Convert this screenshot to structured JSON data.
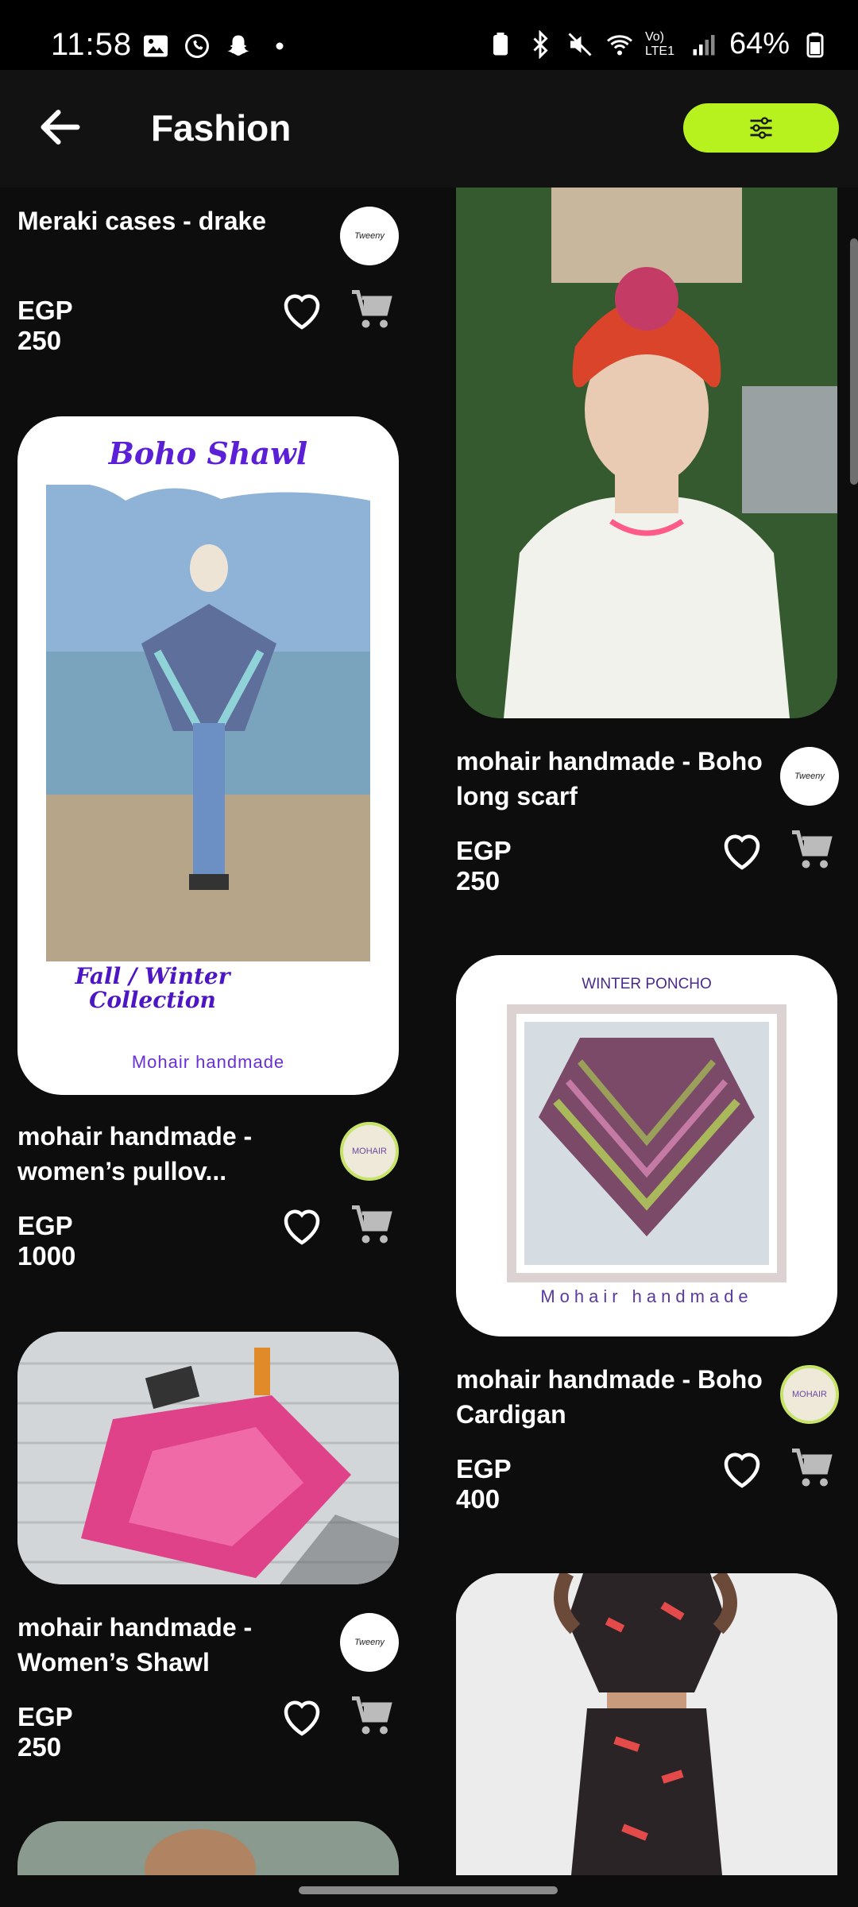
{
  "status": {
    "time": "11:58",
    "battery": "64%",
    "network": "Vo) LTE1"
  },
  "header": {
    "title": "Fashion",
    "icons": {
      "back": "back-arrow-icon",
      "filter": "filter-sliders-icon"
    }
  },
  "products": [
    {
      "name": "Meraki cases  - drake",
      "price": "EGP 250"
    },
    {
      "name": "mohair handmade - Boho long scarf",
      "price": "EGP 250"
    },
    {
      "name": "mohair handmade - women’s pullov...",
      "price": "EGP 1000",
      "image_text": {
        "title": "Boho Shawl",
        "subtitle": "Fall / Winter Collection",
        "footer": "Mohair handmade"
      }
    },
    {
      "name": "mohair handmade - Boho Cardigan",
      "price": "EGP 400",
      "image_text": {
        "title": "WINTER PONCHO",
        "footer": "Mohair handmade"
      }
    },
    {
      "name": "mohair handmade - Women’s Shawl",
      "price": "EGP 250"
    }
  ],
  "colors": {
    "accent": "#b8f21e",
    "background": "#0d0d0d"
  }
}
